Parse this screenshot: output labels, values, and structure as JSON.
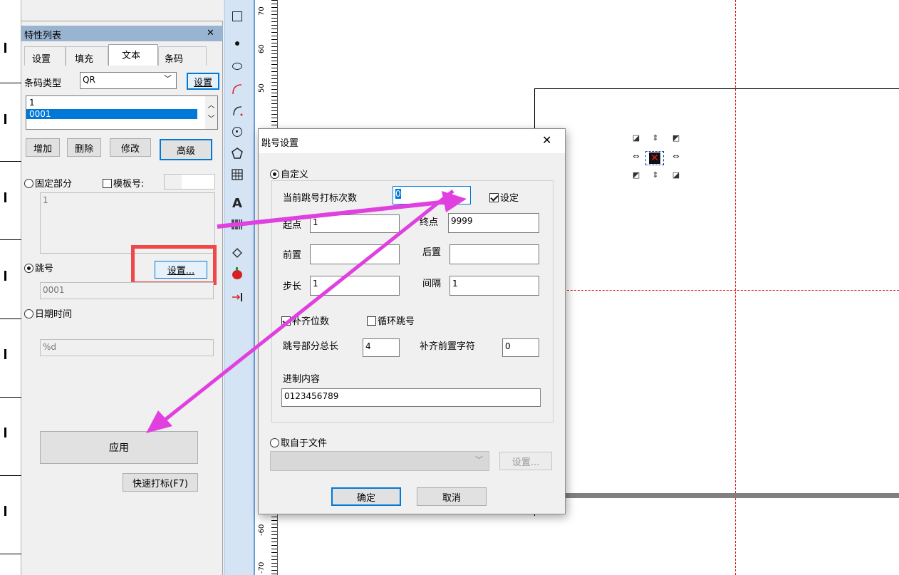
{
  "left_panel": {
    "title": "特性列表",
    "close_glyph": "✕",
    "tabs": [
      "设置",
      "填充",
      "文本",
      "条码"
    ],
    "active_tab": "文本",
    "barcode_type_label": "条码类型",
    "barcode_type_value": "QR",
    "settings_btn": "设置",
    "list_items": [
      "1",
      "0001"
    ],
    "add_btn": "增加",
    "delete_btn": "删除",
    "modify_btn": "修改",
    "advanced_btn": "高级",
    "fixed_part_label": "固定部分",
    "template_num_label": "模板号:",
    "fixed_text": "1",
    "jump_label": "跳号",
    "jump_settings_btn": "设置...",
    "jump_value": "0001",
    "datetime_label": "日期时间",
    "datetime_value": "%d",
    "apply_btn": "应用",
    "quick_mark_btn": "快速打标(F7)"
  },
  "ruler": {
    "labels": [
      "70",
      "60",
      "50",
      "-60",
      "-70"
    ]
  },
  "dialog": {
    "title": "跳号设置",
    "close_glyph": "✕",
    "custom_label": "自定义",
    "current_count_label": "当前跳号打标次数",
    "current_count_value": "0",
    "set_label": "设定",
    "start_label": "起点",
    "start_value": "1",
    "end_label": "终点",
    "end_value": "9999",
    "prefix_label": "前置",
    "prefix_value": "",
    "suffix_label": "后置",
    "suffix_value": "",
    "step_label": "步长",
    "step_value": "1",
    "interval_label": "间隔",
    "interval_value": "1",
    "pad_digits_label": "补齐位数",
    "loop_jump_label": "循环跳号",
    "total_length_label": "跳号部分总长",
    "total_length_value": "4",
    "pad_char_label": "补齐前置字符",
    "pad_char_value": "0",
    "radix_label": "进制内容",
    "radix_value": "0123456789",
    "from_file_label": "取自于文件",
    "file_settings_btn": "设置...",
    "ok_btn": "确定",
    "cancel_btn": "取消"
  },
  "colors": {
    "panel_bg": "#f0f0f0",
    "title_bar": "#99b4d1",
    "accent": "#0078d7",
    "highlight_box": "#f04848",
    "arrow": "#e040e0",
    "guide": "#e02020"
  }
}
